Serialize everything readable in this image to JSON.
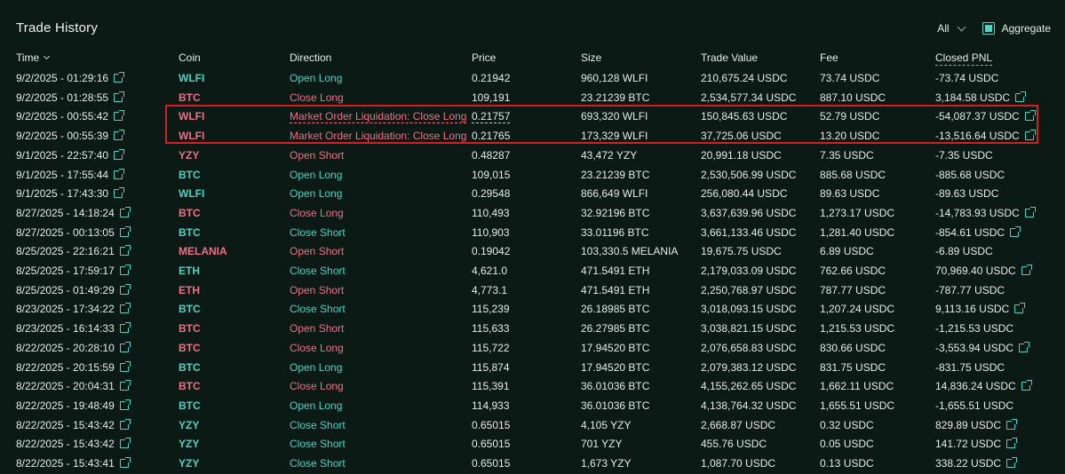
{
  "header": {
    "title": "Trade History",
    "filter_label": "All",
    "aggregate_label": "Aggregate"
  },
  "columns": {
    "time": "Time",
    "coin": "Coin",
    "direction": "Direction",
    "price": "Price",
    "size": "Size",
    "trade_value": "Trade Value",
    "fee": "Fee",
    "closed_pnl": "Closed PNL"
  },
  "colors": {
    "green": "#50d2c1",
    "red": "#ed7088",
    "highlight": "#d61f1f"
  },
  "rows": [
    {
      "time": "9/2/2025 - 01:29:16",
      "coin": "WLFI",
      "coin_color": "green",
      "direction": "Open Long",
      "dir_color": "green",
      "price": "0.21942",
      "size": "960,128 WLFI",
      "trade_value": "210,675.24 USDC",
      "fee": "73.74 USDC",
      "pnl": "-73.74 USDC",
      "pnl_link": false
    },
    {
      "time": "9/2/2025 - 01:28:55",
      "coin": "BTC",
      "coin_color": "red",
      "direction": "Close Long",
      "dir_color": "red",
      "price": "109,191",
      "size": "23.21239 BTC",
      "trade_value": "2,534,577.34 USDC",
      "fee": "887.10 USDC",
      "pnl": "3,184.58 USDC",
      "pnl_link": true
    },
    {
      "time": "9/2/2025 - 00:55:42",
      "coin": "WLFI",
      "coin_color": "red",
      "direction": "Market Order Liquidation: Close Long",
      "dir_color": "red",
      "price": "0.21757",
      "size": "693,320 WLFI",
      "trade_value": "150,845.63 USDC",
      "fee": "52.79 USDC",
      "pnl": "-54,087.37 USDC",
      "pnl_link": true
    },
    {
      "time": "9/2/2025 - 00:55:39",
      "coin": "WLFI",
      "coin_color": "red",
      "direction": "Market Order Liquidation: Close Long",
      "dir_color": "red",
      "price": "0.21765",
      "size": "173,329 WLFI",
      "trade_value": "37,725.06 USDC",
      "fee": "13.20 USDC",
      "pnl": "-13,516.64 USDC",
      "pnl_link": true
    },
    {
      "time": "9/1/2025 - 22:57:40",
      "coin": "YZY",
      "coin_color": "red",
      "direction": "Open Short",
      "dir_color": "red",
      "price": "0.48287",
      "size": "43,472 YZY",
      "trade_value": "20,991.18 USDC",
      "fee": "7.35 USDC",
      "pnl": "-7.35 USDC",
      "pnl_link": false
    },
    {
      "time": "9/1/2025 - 17:55:44",
      "coin": "BTC",
      "coin_color": "green",
      "direction": "Open Long",
      "dir_color": "green",
      "price": "109,015",
      "size": "23.21239 BTC",
      "trade_value": "2,530,506.99 USDC",
      "fee": "885.68 USDC",
      "pnl": "-885.68 USDC",
      "pnl_link": false
    },
    {
      "time": "9/1/2025 - 17:43:30",
      "coin": "WLFI",
      "coin_color": "green",
      "direction": "Open Long",
      "dir_color": "green",
      "price": "0.29548",
      "size": "866,649 WLFI",
      "trade_value": "256,080.44 USDC",
      "fee": "89.63 USDC",
      "pnl": "-89.63 USDC",
      "pnl_link": false
    },
    {
      "time": "8/27/2025 - 14:18:24",
      "coin": "BTC",
      "coin_color": "red",
      "direction": "Close Long",
      "dir_color": "red",
      "price": "110,493",
      "size": "32.92196 BTC",
      "trade_value": "3,637,639.96 USDC",
      "fee": "1,273.17 USDC",
      "pnl": "-14,783.93 USDC",
      "pnl_link": true
    },
    {
      "time": "8/27/2025 - 00:13:05",
      "coin": "BTC",
      "coin_color": "green",
      "direction": "Close Short",
      "dir_color": "green",
      "price": "110,903",
      "size": "33.01196 BTC",
      "trade_value": "3,661,133.46 USDC",
      "fee": "1,281.40 USDC",
      "pnl": "-854.61 USDC",
      "pnl_link": true
    },
    {
      "time": "8/25/2025 - 22:16:21",
      "coin": "MELANIA",
      "coin_color": "red",
      "direction": "Open Short",
      "dir_color": "red",
      "price": "0.19042",
      "size": "103,330.5 MELANIA",
      "trade_value": "19,675.75 USDC",
      "fee": "6.89 USDC",
      "pnl": "-6.89 USDC",
      "pnl_link": false
    },
    {
      "time": "8/25/2025 - 17:59:17",
      "coin": "ETH",
      "coin_color": "green",
      "direction": "Close Short",
      "dir_color": "green",
      "price": "4,621.0",
      "size": "471.5491 ETH",
      "trade_value": "2,179,033.09 USDC",
      "fee": "762.66 USDC",
      "pnl": "70,969.40 USDC",
      "pnl_link": true
    },
    {
      "time": "8/25/2025 - 01:49:29",
      "coin": "ETH",
      "coin_color": "red",
      "direction": "Open Short",
      "dir_color": "red",
      "price": "4,773.1",
      "size": "471.5491 ETH",
      "trade_value": "2,250,768.97 USDC",
      "fee": "787.77 USDC",
      "pnl": "-787.77 USDC",
      "pnl_link": false
    },
    {
      "time": "8/23/2025 - 17:34:22",
      "coin": "BTC",
      "coin_color": "green",
      "direction": "Close Short",
      "dir_color": "green",
      "price": "115,239",
      "size": "26.18985 BTC",
      "trade_value": "3,018,093.15 USDC",
      "fee": "1,207.24 USDC",
      "pnl": "9,113.16 USDC",
      "pnl_link": true
    },
    {
      "time": "8/23/2025 - 16:14:33",
      "coin": "BTC",
      "coin_color": "red",
      "direction": "Open Short",
      "dir_color": "red",
      "price": "115,633",
      "size": "26.27985 BTC",
      "trade_value": "3,038,821.15 USDC",
      "fee": "1,215.53 USDC",
      "pnl": "-1,215.53 USDC",
      "pnl_link": false
    },
    {
      "time": "8/22/2025 - 20:28:10",
      "coin": "BTC",
      "coin_color": "red",
      "direction": "Close Long",
      "dir_color": "red",
      "price": "115,722",
      "size": "17.94520 BTC",
      "trade_value": "2,076,658.83 USDC",
      "fee": "830.66 USDC",
      "pnl": "-3,553.94 USDC",
      "pnl_link": true
    },
    {
      "time": "8/22/2025 - 20:15:59",
      "coin": "BTC",
      "coin_color": "green",
      "direction": "Open Long",
      "dir_color": "green",
      "price": "115,874",
      "size": "17.94520 BTC",
      "trade_value": "2,079,383.12 USDC",
      "fee": "831.75 USDC",
      "pnl": "-831.75 USDC",
      "pnl_link": false
    },
    {
      "time": "8/22/2025 - 20:04:31",
      "coin": "BTC",
      "coin_color": "red",
      "direction": "Close Long",
      "dir_color": "red",
      "price": "115,391",
      "size": "36.01036 BTC",
      "trade_value": "4,155,262.65 USDC",
      "fee": "1,662.11 USDC",
      "pnl": "14,836.24 USDC",
      "pnl_link": true
    },
    {
      "time": "8/22/2025 - 19:48:49",
      "coin": "BTC",
      "coin_color": "green",
      "direction": "Open Long",
      "dir_color": "green",
      "price": "114,933",
      "size": "36.01036 BTC",
      "trade_value": "4,138,764.32 USDC",
      "fee": "1,655.51 USDC",
      "pnl": "-1,655.51 USDC",
      "pnl_link": false
    },
    {
      "time": "8/22/2025 - 15:43:42",
      "coin": "YZY",
      "coin_color": "green",
      "direction": "Close Short",
      "dir_color": "green",
      "price": "0.65015",
      "size": "4,105 YZY",
      "trade_value": "2,668.87 USDC",
      "fee": "0.32 USDC",
      "pnl": "829.89 USDC",
      "pnl_link": true
    },
    {
      "time": "8/22/2025 - 15:43:42",
      "coin": "YZY",
      "coin_color": "green",
      "direction": "Close Short",
      "dir_color": "green",
      "price": "0.65015",
      "size": "701 YZY",
      "trade_value": "455.76 USDC",
      "fee": "0.05 USDC",
      "pnl": "141.72 USDC",
      "pnl_link": true
    },
    {
      "time": "8/22/2025 - 15:43:41",
      "coin": "YZY",
      "coin_color": "green",
      "direction": "Close Short",
      "dir_color": "green",
      "price": "0.65015",
      "size": "1,673 YZY",
      "trade_value": "1,087.70 USDC",
      "fee": "0.13 USDC",
      "pnl": "338.22 USDC",
      "pnl_link": true
    }
  ]
}
